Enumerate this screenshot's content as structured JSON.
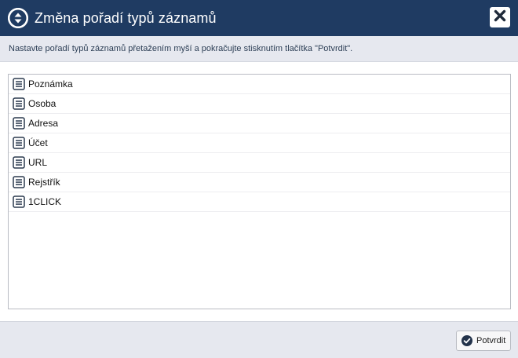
{
  "dialog": {
    "title": "Změna pořadí typů záznamů",
    "title_icon": "sort-arrows-icon",
    "close_icon": "close-icon",
    "instructions": "Nastavte pořadí typů záznamů přetažením myší a pokračujte stisknutím tlačítka \"Potvrdit\"."
  },
  "record_types": {
    "item_icon": "list-document-icon",
    "items": [
      {
        "label": "Poznámka"
      },
      {
        "label": "Osoba"
      },
      {
        "label": "Adresa"
      },
      {
        "label": "Účet"
      },
      {
        "label": "URL"
      },
      {
        "label": "Rejstřík"
      },
      {
        "label": "1CLICK"
      }
    ]
  },
  "footer": {
    "confirm_label": "Potvrdit",
    "confirm_icon": "check-circle-icon"
  },
  "colors": {
    "titlebar": "#1f3b62",
    "panel": "#e6e8ef",
    "icon_dark": "#2b3a4f"
  }
}
